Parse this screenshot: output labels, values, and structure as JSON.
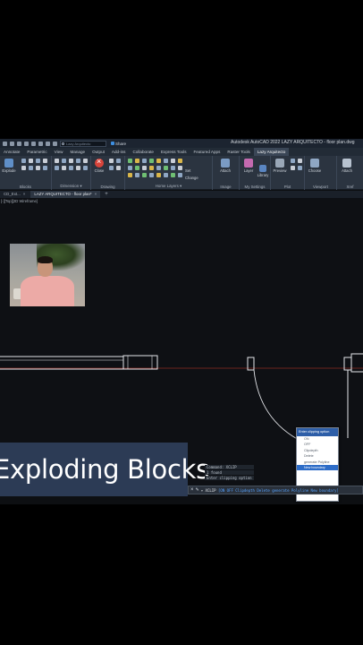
{
  "app_title": "Autodesk AutoCAD 2022    LAZY ARQUITECTO - floor plan.dwg",
  "search_placeholder": "Lazy Arquitecto",
  "share_label": "Share",
  "ribbon_tabs": [
    "Annotate",
    "Parametric",
    "View",
    "Manage",
    "Output",
    "Add-ins",
    "Collaborate",
    "Express Tools",
    "Featured Apps",
    "Raster Tools",
    "Lazy Arquitecto"
  ],
  "active_tab_index": 10,
  "ribbon_panels": [
    "Blocks",
    "Dimension ▾",
    "Drawing",
    "Home Layers ▾",
    "Image",
    "My Settings",
    "Plot",
    "Viewport",
    "Xref"
  ],
  "ribbon_buttons": {
    "explode": "Explode",
    "layer": "Layer",
    "close": "Close",
    "set": "Set",
    "change": "Change",
    "attach": "Attach",
    "library": "Library",
    "preview": "Preview",
    "choose": "Choose",
    "attach2": "Attach"
  },
  "file_tabs": [
    "CD_Ext...",
    "LAZY ARQUITECTO - floor plan*"
  ],
  "viewport_label": "[-][Top][2D Wireframe]",
  "caption": "Exploding Blocks",
  "context_menu": {
    "title": "Enter clipping option",
    "items": [
      "ON",
      "OFF",
      "Clipdepth",
      "Delete",
      "generate Polyline",
      "New boundary"
    ],
    "selected_index": 5
  },
  "command_history": [
    "Command: XCLIP",
    "1 found",
    "Enter clipping option"
  ],
  "command_line": {
    "prefix": "▾ XCLIP",
    "text": "[ON OFF Clipdepth Delete generate Polyline New boundary]"
  },
  "colors": {
    "ribbon_bg": "#2b3440",
    "canvas_bg": "#0e1014",
    "caption_bg": "#2c3b55",
    "menu_highlight": "#2d6cc7",
    "red_line": "#c0392b"
  }
}
